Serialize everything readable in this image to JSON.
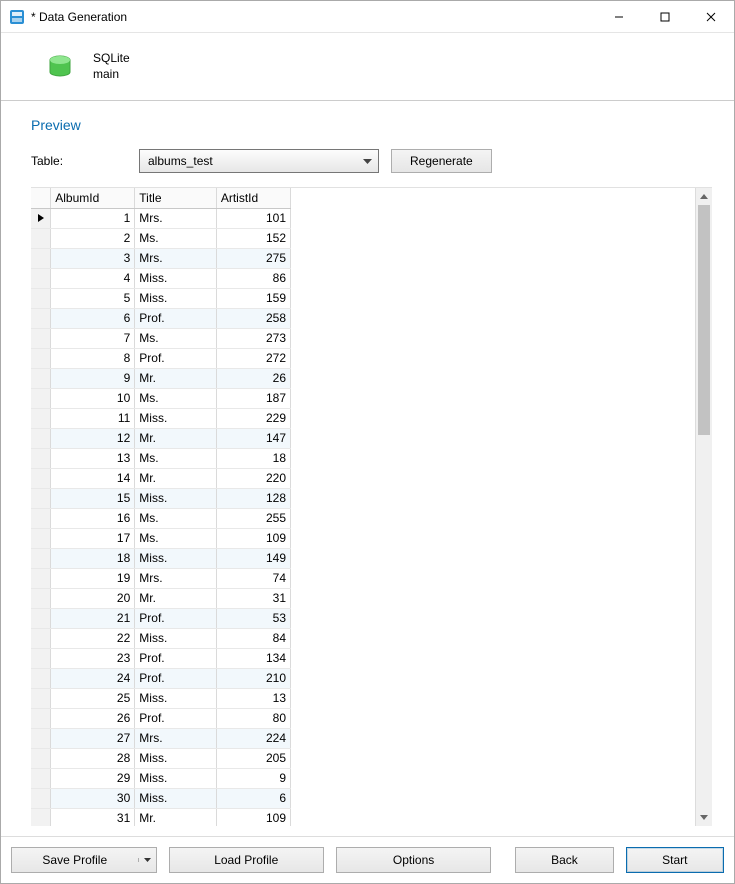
{
  "window": {
    "title": "* Data Generation"
  },
  "connection": {
    "type": "SQLite",
    "db": "main"
  },
  "preview": {
    "heading": "Preview",
    "table_label": "Table:",
    "table_value": "albums_test",
    "regenerate": "Regenerate"
  },
  "columns": {
    "album": "AlbumId",
    "title": "Title",
    "artist": "ArtistId"
  },
  "rows": [
    {
      "album": 1,
      "title": "Mrs.",
      "artist": 101
    },
    {
      "album": 2,
      "title": "Ms.",
      "artist": 152
    },
    {
      "album": 3,
      "title": "Mrs.",
      "artist": 275
    },
    {
      "album": 4,
      "title": "Miss.",
      "artist": 86
    },
    {
      "album": 5,
      "title": "Miss.",
      "artist": 159
    },
    {
      "album": 6,
      "title": "Prof.",
      "artist": 258
    },
    {
      "album": 7,
      "title": "Ms.",
      "artist": 273
    },
    {
      "album": 8,
      "title": "Prof.",
      "artist": 272
    },
    {
      "album": 9,
      "title": "Mr.",
      "artist": 26
    },
    {
      "album": 10,
      "title": "Ms.",
      "artist": 187
    },
    {
      "album": 11,
      "title": "Miss.",
      "artist": 229
    },
    {
      "album": 12,
      "title": "Mr.",
      "artist": 147
    },
    {
      "album": 13,
      "title": "Ms.",
      "artist": 18
    },
    {
      "album": 14,
      "title": "Mr.",
      "artist": 220
    },
    {
      "album": 15,
      "title": "Miss.",
      "artist": 128
    },
    {
      "album": 16,
      "title": "Ms.",
      "artist": 255
    },
    {
      "album": 17,
      "title": "Ms.",
      "artist": 109
    },
    {
      "album": 18,
      "title": "Miss.",
      "artist": 149
    },
    {
      "album": 19,
      "title": "Mrs.",
      "artist": 74
    },
    {
      "album": 20,
      "title": "Mr.",
      "artist": 31
    },
    {
      "album": 21,
      "title": "Prof.",
      "artist": 53
    },
    {
      "album": 22,
      "title": "Miss.",
      "artist": 84
    },
    {
      "album": 23,
      "title": "Prof.",
      "artist": 134
    },
    {
      "album": 24,
      "title": "Prof.",
      "artist": 210
    },
    {
      "album": 25,
      "title": "Miss.",
      "artist": 13
    },
    {
      "album": 26,
      "title": "Prof.",
      "artist": 80
    },
    {
      "album": 27,
      "title": "Mrs.",
      "artist": 224
    },
    {
      "album": 28,
      "title": "Miss.",
      "artist": 205
    },
    {
      "album": 29,
      "title": "Miss.",
      "artist": 9
    },
    {
      "album": 30,
      "title": "Miss.",
      "artist": 6
    },
    {
      "album": 31,
      "title": "Mr.",
      "artist": 109
    }
  ],
  "footer": {
    "save_profile": "Save Profile",
    "load_profile": "Load Profile",
    "options": "Options",
    "back": "Back",
    "start": "Start"
  }
}
